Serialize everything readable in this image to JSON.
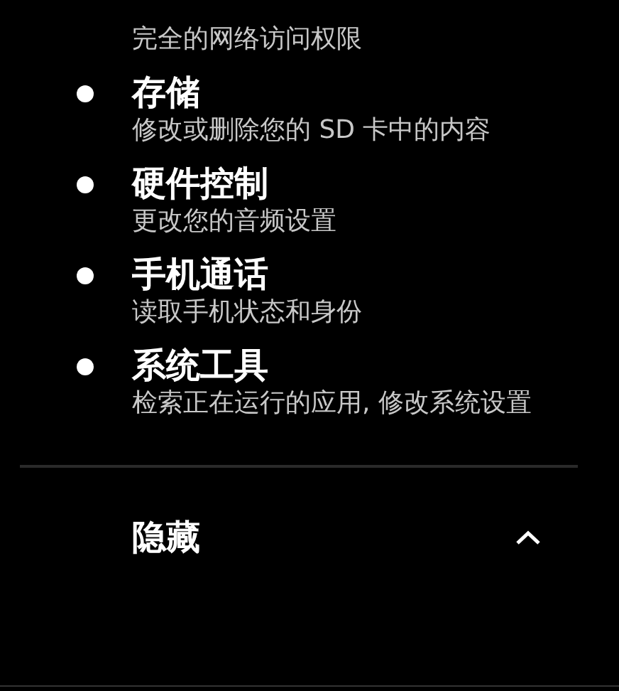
{
  "leading_description": "完全的网络访问权限",
  "permissions": [
    {
      "title": "存储",
      "description": "修改或删除您的 SD 卡中的内容"
    },
    {
      "title": "硬件控制",
      "description": "更改您的音频设置"
    },
    {
      "title": "手机通话",
      "description": "读取手机状态和身份"
    },
    {
      "title": "系统工具",
      "description": "检索正在运行的应用, 修改系统设置"
    }
  ],
  "toggle": {
    "label": "隐藏",
    "expanded": true
  }
}
